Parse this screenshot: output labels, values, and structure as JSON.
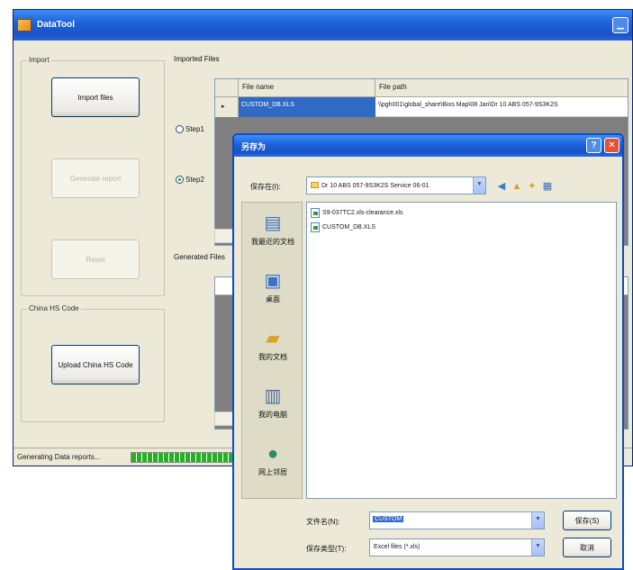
{
  "app": {
    "title": "DataTool",
    "import_group": {
      "label": "Import",
      "import_files_button": "Import files",
      "generate_report_button": "Generate report",
      "reset_button": "Reset"
    },
    "imported_files": {
      "label": "Imported Files",
      "columns": [
        "File name",
        "File path"
      ],
      "rows": [
        {
          "selector": "▸",
          "file_name": "CUSTOM_DB.XLS",
          "file_path": "\\\\pgh001\\global_share\\Bios Map\\08 Jan\\Dr 10 ABS 057-9S3K2S"
        }
      ],
      "step1_label": "Step1",
      "step2_label": "Step2"
    },
    "generated_files_label": "Generated Files",
    "china_group": {
      "label": "China HS Code",
      "upload_button": "Upload China HS Code"
    },
    "status": {
      "text": "Generating Data reports...",
      "progress": 1.0
    }
  },
  "dialog": {
    "title": "另存为",
    "look_in_label": "保存在(I):",
    "look_in_value": "Dr 10 ABS 057-9S3K2S Service 06-01",
    "places": [
      "我最近的文档",
      "桌面",
      "我的文档",
      "我的电脑",
      "网上邻居"
    ],
    "files": [
      "S9-037TC2.xls-clearance.xls",
      "CUSTOM_DB.XLS"
    ],
    "filename_label": "文件名(N):",
    "filename_value": "CUSTOM",
    "filetype_label": "保存类型(T):",
    "filetype_value": "Excel files (*.xls)",
    "save_button": "保存(S)",
    "cancel_button": "取消",
    "help_glyph": "?",
    "close_glyph": "✕"
  },
  "colors": {
    "titlebar": "#1c5fd6",
    "window": "#ece9d8",
    "selection": "#316ac5",
    "progress": "#26b026"
  }
}
